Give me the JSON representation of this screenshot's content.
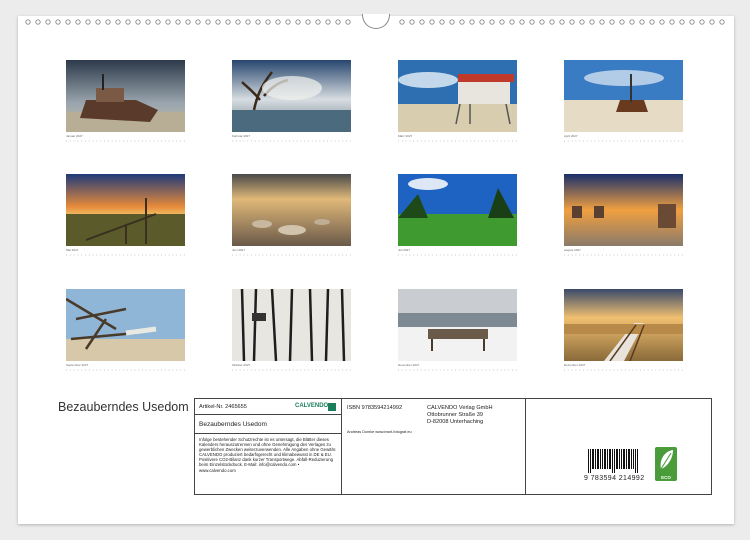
{
  "calendar": {
    "title": "Bezauberndes Usedom",
    "months": [
      {
        "caption": "Januar 2027"
      },
      {
        "caption": "Februar 2027"
      },
      {
        "caption": "März 2027"
      },
      {
        "caption": "April 2027"
      },
      {
        "caption": "Mai 2027"
      },
      {
        "caption": "Juni 2027"
      },
      {
        "caption": "Juli 2027"
      },
      {
        "caption": "August 2027"
      },
      {
        "caption": "September 2027"
      },
      {
        "caption": "Oktober 2027"
      },
      {
        "caption": "November 2027"
      },
      {
        "caption": "Dezember 2027"
      }
    ]
  },
  "info": {
    "article": "Artikel-Nr. 2465655",
    "product_title": "Bezauberndes Usedom",
    "calvendo_logo": "CALVENDO",
    "legal_text": "Infolge bestehender Schutzrechte ist es untersagt, die Blätter dieses Kalenders herauszutrennen und ohne Genehmigung des Verlages zu gewerblichen Zwecken weiterzuverwenden. Alle Angaben ohne Gewähr. CALVENDO produziert bedarfsgerecht und klimabewusst in DE & EU. Positivere CO2-Bilanz dank kurzer Transportwege. Abfall-Reduzierung beim Einzelstückdruck. E-Mail: info@calvendo.com • www.calvendo.com",
    "isbn": "ISBN 9783594214992",
    "publisher_name": "CALVENDO Verlag GmbH",
    "publisher_street": "Ottobrunner Straße 39",
    "publisher_city": "D-82008 Unterhaching",
    "photographer": "Andreas Dumke www.insel-fotograf.eu",
    "barcode_digits": "9 783594 214992",
    "eco_label": "ECO"
  },
  "colors": {
    "eco_green": "#4a9b3a",
    "calvendo_green": "#1a7f5a"
  }
}
